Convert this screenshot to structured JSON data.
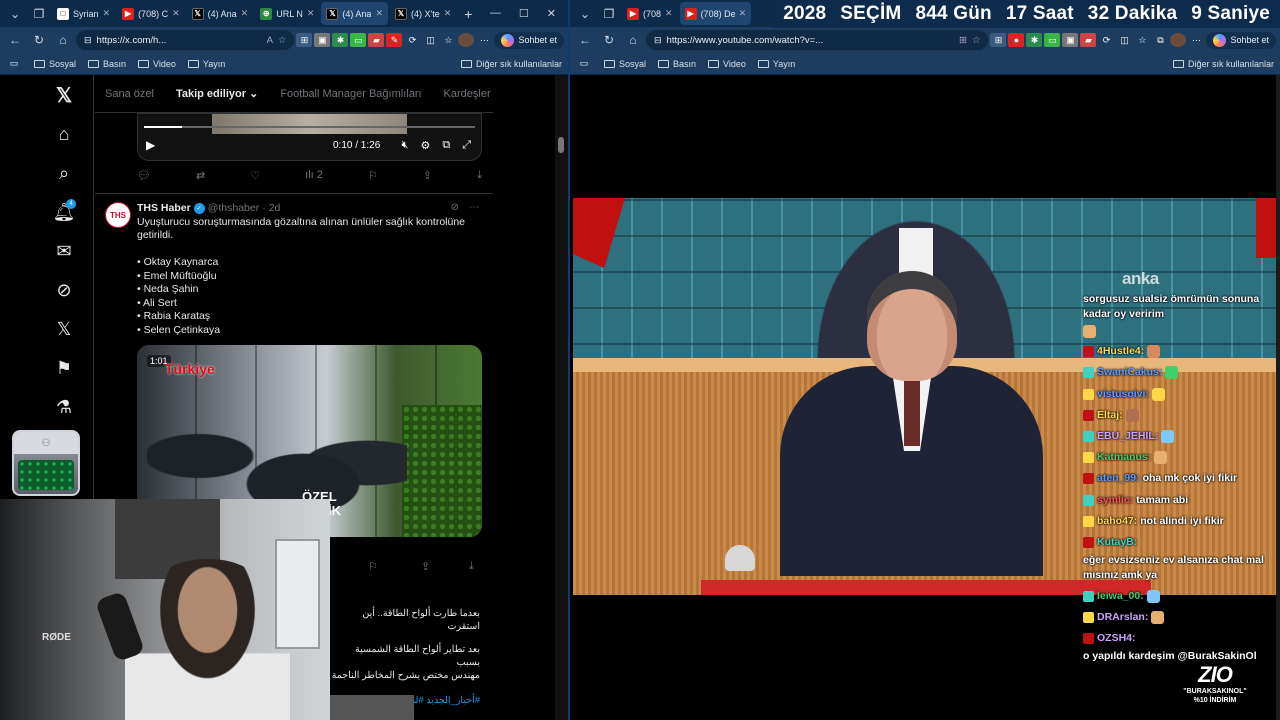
{
  "left_browser": {
    "tabs": [
      {
        "label": "Syrian",
        "icon": "g",
        "active": false
      },
      {
        "label": "(708) C",
        "icon": "yt",
        "active": false
      },
      {
        "label": "(4) Ana",
        "icon": "x",
        "active": false
      },
      {
        "label": "URL N",
        "icon": "url",
        "active": false
      },
      {
        "label": "(4) Ana",
        "icon": "x",
        "active": true
      },
      {
        "label": "(4) X'te",
        "icon": "x",
        "active": false
      }
    ],
    "address": "https://x.com/h...",
    "copilot_label": "Sohbet et",
    "bookmarks": [
      "Sosyal",
      "Basın",
      "Video",
      "Yayın"
    ],
    "other_bookmarks": "Diğer sık kullanılanlar"
  },
  "right_browser": {
    "tabs": [
      {
        "label": "(708",
        "icon": "yt",
        "active": false
      },
      {
        "label": "(708) De",
        "icon": "yt",
        "active": true
      }
    ],
    "address": "https://www.youtube.com/watch?v=...",
    "copilot_label": "Sohbet et",
    "bookmarks": [
      "Sosyal",
      "Basın",
      "Video",
      "Yayın"
    ],
    "other_bookmarks": "Diğer sık kullanılanlar"
  },
  "countdown": {
    "year": "2028",
    "label": "SEÇİM",
    "days": "844 Gün",
    "hours": "17 Saat",
    "minutes": "32 Dakika",
    "seconds": "9 Saniye"
  },
  "x": {
    "feed_tabs": [
      "Sana özel",
      "Takip ediliyor",
      "Football Manager Bağımlıları",
      "Kardeşler Kıra"
    ],
    "active_feed_tab": "Takip ediliyor",
    "notification_count": "4",
    "video1": {
      "time": "0:10 / 1:26",
      "views": "2"
    },
    "tweet": {
      "avatar_text": "THS",
      "name": "THS Haber",
      "handle": "@thshaber",
      "age": "2d",
      "text": "Uyuşturucu soruşturmasında gözaltına alınan ünlüler sağlık kontrolüne getirildi.",
      "list": [
        "• Oktay Kaynarca",
        "• Emel Müftüoğlu",
        "• Neda Şahin",
        "• Ali Sert",
        "• Rabia Karataş",
        "• Selen Çetinkaya"
      ],
      "media_logo": "Türkiye",
      "media_time": "1:01",
      "media_text": "ÖZEL\nENLİK"
    },
    "arabic_tweet": {
      "line1": "بعدما طارت ألواح الطاقة.. أين استقرت",
      "line2": "بعد تطاير ألواح الطاقة الشمسية بسبب",
      "line3": "مهندس مختص يشرح المخاطر الناجمة",
      "hashtags": "#أخبار_الجديد #لبنان #العاصفة"
    },
    "webcam_brand": "RØDE"
  },
  "youtube": {
    "watermark": "anka",
    "chat": [
      {
        "user": "",
        "user_color": "#ffffff",
        "message": "sorgusuz sualsiz ömrümün sonuna kadar oy veririm"
      },
      {
        "user": "4Hustle4:",
        "user_color": "#ffd84a",
        "message": ""
      },
      {
        "user": "SwaniCakus:",
        "user_color": "#5b9bff",
        "message": ""
      },
      {
        "user": "vistusoivi:",
        "user_color": "#5b9bff",
        "message": ""
      },
      {
        "user": "Eltaj:",
        "user_color": "#ffd84a",
        "message": ""
      },
      {
        "user": "EBU_JEHIL:",
        "user_color": "#c9a4ff",
        "message": ""
      },
      {
        "user": "Katmanus:",
        "user_color": "#3fd06b",
        "message": ""
      },
      {
        "user": "aten_99:",
        "user_color": "#5b9bff",
        "message": "oha mk çok iyi fikir"
      },
      {
        "user": "symlic:",
        "user_color": "#ff5555",
        "message": "tamam abi"
      },
      {
        "user": "baho47:",
        "user_color": "#ffd84a",
        "message": "not alindi iyi fikir"
      },
      {
        "user": "KutayB:",
        "user_color": "#3fd0c0",
        "message": "eğer evsizseniz ev alsanıza chat mal mısınız amk ya"
      },
      {
        "user": "leiwa_00:",
        "user_color": "#3fd06b",
        "message": ""
      },
      {
        "user": "DRArslan:",
        "user_color": "#c9a4ff",
        "message": ""
      },
      {
        "user": "OZSH4:",
        "user_color": "#c9a4ff",
        "message": "o yapıldı kardeşim @BurakSakinOl"
      }
    ],
    "promo": {
      "logo": "ZIO",
      "code": "\"BURAKSAKINOL\"",
      "discount": "%10 İNDİRİM"
    }
  },
  "colors": {
    "tabbar": "#0c2a4a",
    "navbar": "#1d3d60",
    "x_blue": "#1d9bf0",
    "banner": "#0d2c4d"
  }
}
